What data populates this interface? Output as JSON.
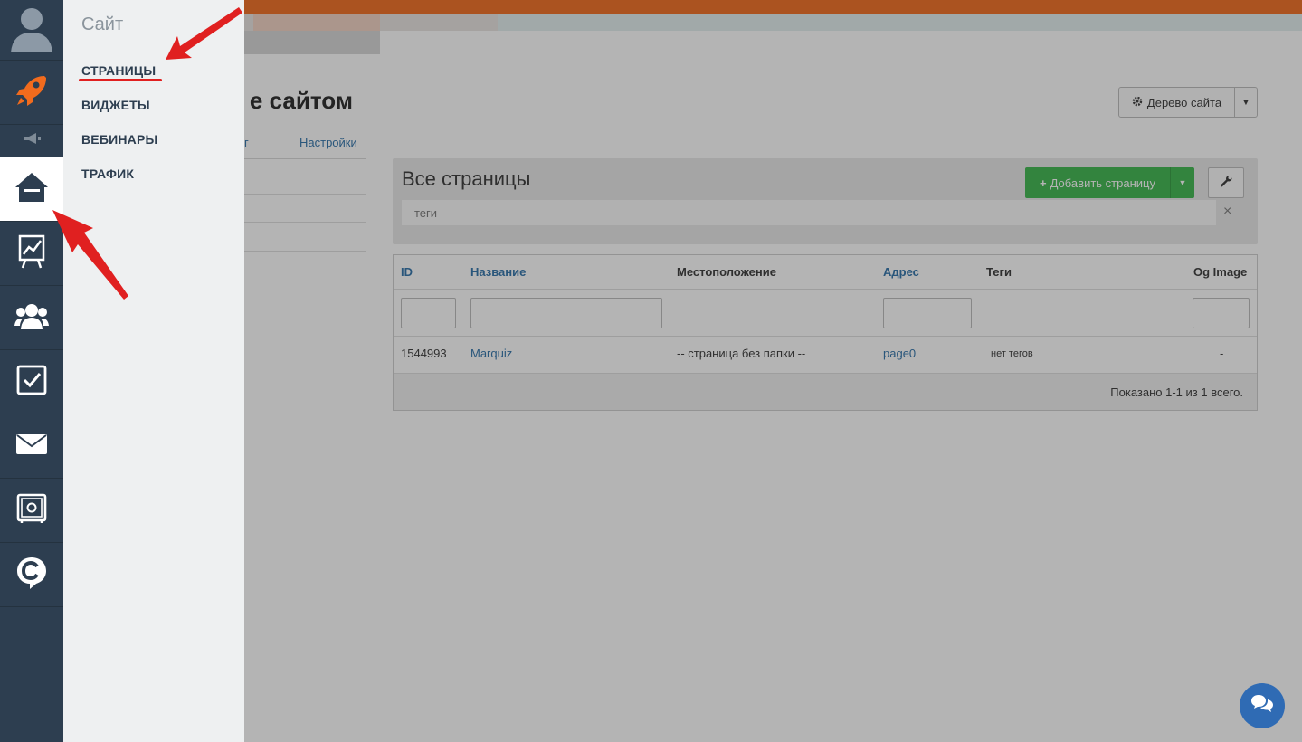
{
  "submenu": {
    "title": "Сайт",
    "items": [
      {
        "label": "СТРАНИЦЫ"
      },
      {
        "label": "ВИДЖЕТЫ"
      },
      {
        "label": "ВЕБИНАРЫ"
      },
      {
        "label": "ТРАФИК"
      }
    ]
  },
  "rail": {
    "icons": [
      "user-avatar-icon",
      "rocket-icon",
      "megaphone-icon",
      "home-icon",
      "chart-icon",
      "users-icon",
      "checkbox-icon",
      "mail-icon",
      "safe-icon",
      "chat-c-icon"
    ],
    "active": "home-icon"
  },
  "header": {
    "title": "е сайтом",
    "tree_button": "Дерево сайта"
  },
  "tabs": {
    "partial": "г",
    "settings": "Настройки"
  },
  "panel": {
    "title": "Все страницы",
    "add_button": "Добавить страницу",
    "tags_placeholder": "теги",
    "clear": "×"
  },
  "grid": {
    "columns": [
      "ID",
      "Название",
      "Местоположение",
      "Адрес",
      "Теги",
      "Og Image"
    ],
    "rows": [
      {
        "id": "1544993",
        "name": "Marquiz",
        "location": "-- страница без папки --",
        "address": "page0",
        "tags": "нет тегов",
        "og": "-"
      }
    ],
    "summary": "Показано 1-1 из 1 всего."
  },
  "colors": {
    "rail": "#2d3e50",
    "submenu": "#eef0f1",
    "accent_green": "#3ab54a",
    "link": "#2a6fa8",
    "rocket": "#f26b1d",
    "annotation_red": "#e02020"
  }
}
